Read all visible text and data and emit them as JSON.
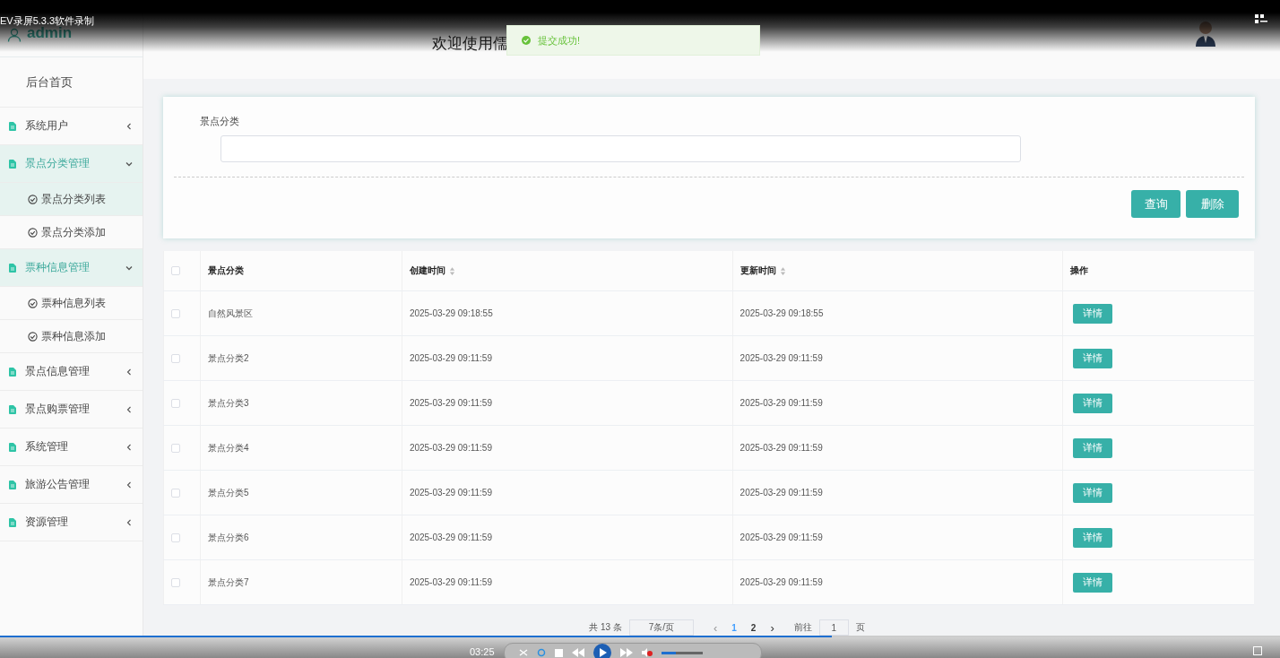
{
  "player": {
    "title": "EV录屏5.3.3软件录制",
    "time": "03:25",
    "level": 0.65,
    "volume": {
      "level": 0.35
    }
  },
  "sidebar": {
    "user": "admin",
    "items": [
      {
        "kind": "link",
        "label": "后台首页"
      },
      {
        "kind": "group",
        "label": "系统用户",
        "expanded": false
      },
      {
        "kind": "group",
        "label": "景点分类管理",
        "expanded": true,
        "children": [
          {
            "label": "景点分类列表",
            "selected": true
          },
          {
            "label": "景点分类添加",
            "selected": false
          }
        ]
      },
      {
        "kind": "group",
        "label": "票种信息管理",
        "expanded": true,
        "children": [
          {
            "label": "票种信息列表",
            "selected": false
          },
          {
            "label": "票种信息添加",
            "selected": false
          }
        ]
      },
      {
        "kind": "group",
        "label": "景点信息管理",
        "expanded": false
      },
      {
        "kind": "group",
        "label": "景点购票管理",
        "expanded": false
      },
      {
        "kind": "group",
        "label": "系统管理",
        "expanded": false
      },
      {
        "kind": "group",
        "label": "旅游公告管理",
        "expanded": false
      },
      {
        "kind": "group",
        "label": "资源管理",
        "expanded": false
      }
    ]
  },
  "header": {
    "title": "欢迎使用儒"
  },
  "toast": {
    "message": "提交成功!"
  },
  "search": {
    "label": "景点分类",
    "buttons": [
      "查询",
      "删除"
    ]
  },
  "table": {
    "select_all": {
      "checked": false
    },
    "columns": [
      {
        "label": "景点分类",
        "sortable": false
      },
      {
        "label": "创建时间",
        "sortable": true
      },
      {
        "label": "更新时间",
        "sortable": true
      },
      {
        "label": "操作",
        "sortable": false
      }
    ],
    "rows": [
      {
        "checked": false,
        "cells": [
          "自然风景区",
          "2025-03-29 09:18:55",
          "2025-03-29 09:18:55"
        ],
        "action": "详情"
      },
      {
        "checked": false,
        "cells": [
          "景点分类2",
          "2025-03-29 09:11:59",
          "2025-03-29 09:11:59"
        ],
        "action": "详情"
      },
      {
        "checked": false,
        "cells": [
          "景点分类3",
          "2025-03-29 09:11:59",
          "2025-03-29 09:11:59"
        ],
        "action": "详情"
      },
      {
        "checked": false,
        "cells": [
          "景点分类4",
          "2025-03-29 09:11:59",
          "2025-03-29 09:11:59"
        ],
        "action": "详情"
      },
      {
        "checked": false,
        "cells": [
          "景点分类5",
          "2025-03-29 09:11:59",
          "2025-03-29 09:11:59"
        ],
        "action": "详情"
      },
      {
        "checked": false,
        "cells": [
          "景点分类6",
          "2025-03-29 09:11:59",
          "2025-03-29 09:11:59"
        ],
        "action": "详情"
      },
      {
        "checked": false,
        "cells": [
          "景点分类7",
          "2025-03-29 09:11:59",
          "2025-03-29 09:11:59"
        ],
        "action": "详情"
      }
    ]
  },
  "pagination": {
    "total": "共 13 条",
    "page_size": "7条/页",
    "prev": "‹",
    "next": "›",
    "pages": [
      {
        "label": "1",
        "selected": true
      },
      {
        "label": "2",
        "selected": false
      }
    ],
    "goto_label": "前往",
    "goto_value": "1",
    "goto_suffix": "页"
  }
}
